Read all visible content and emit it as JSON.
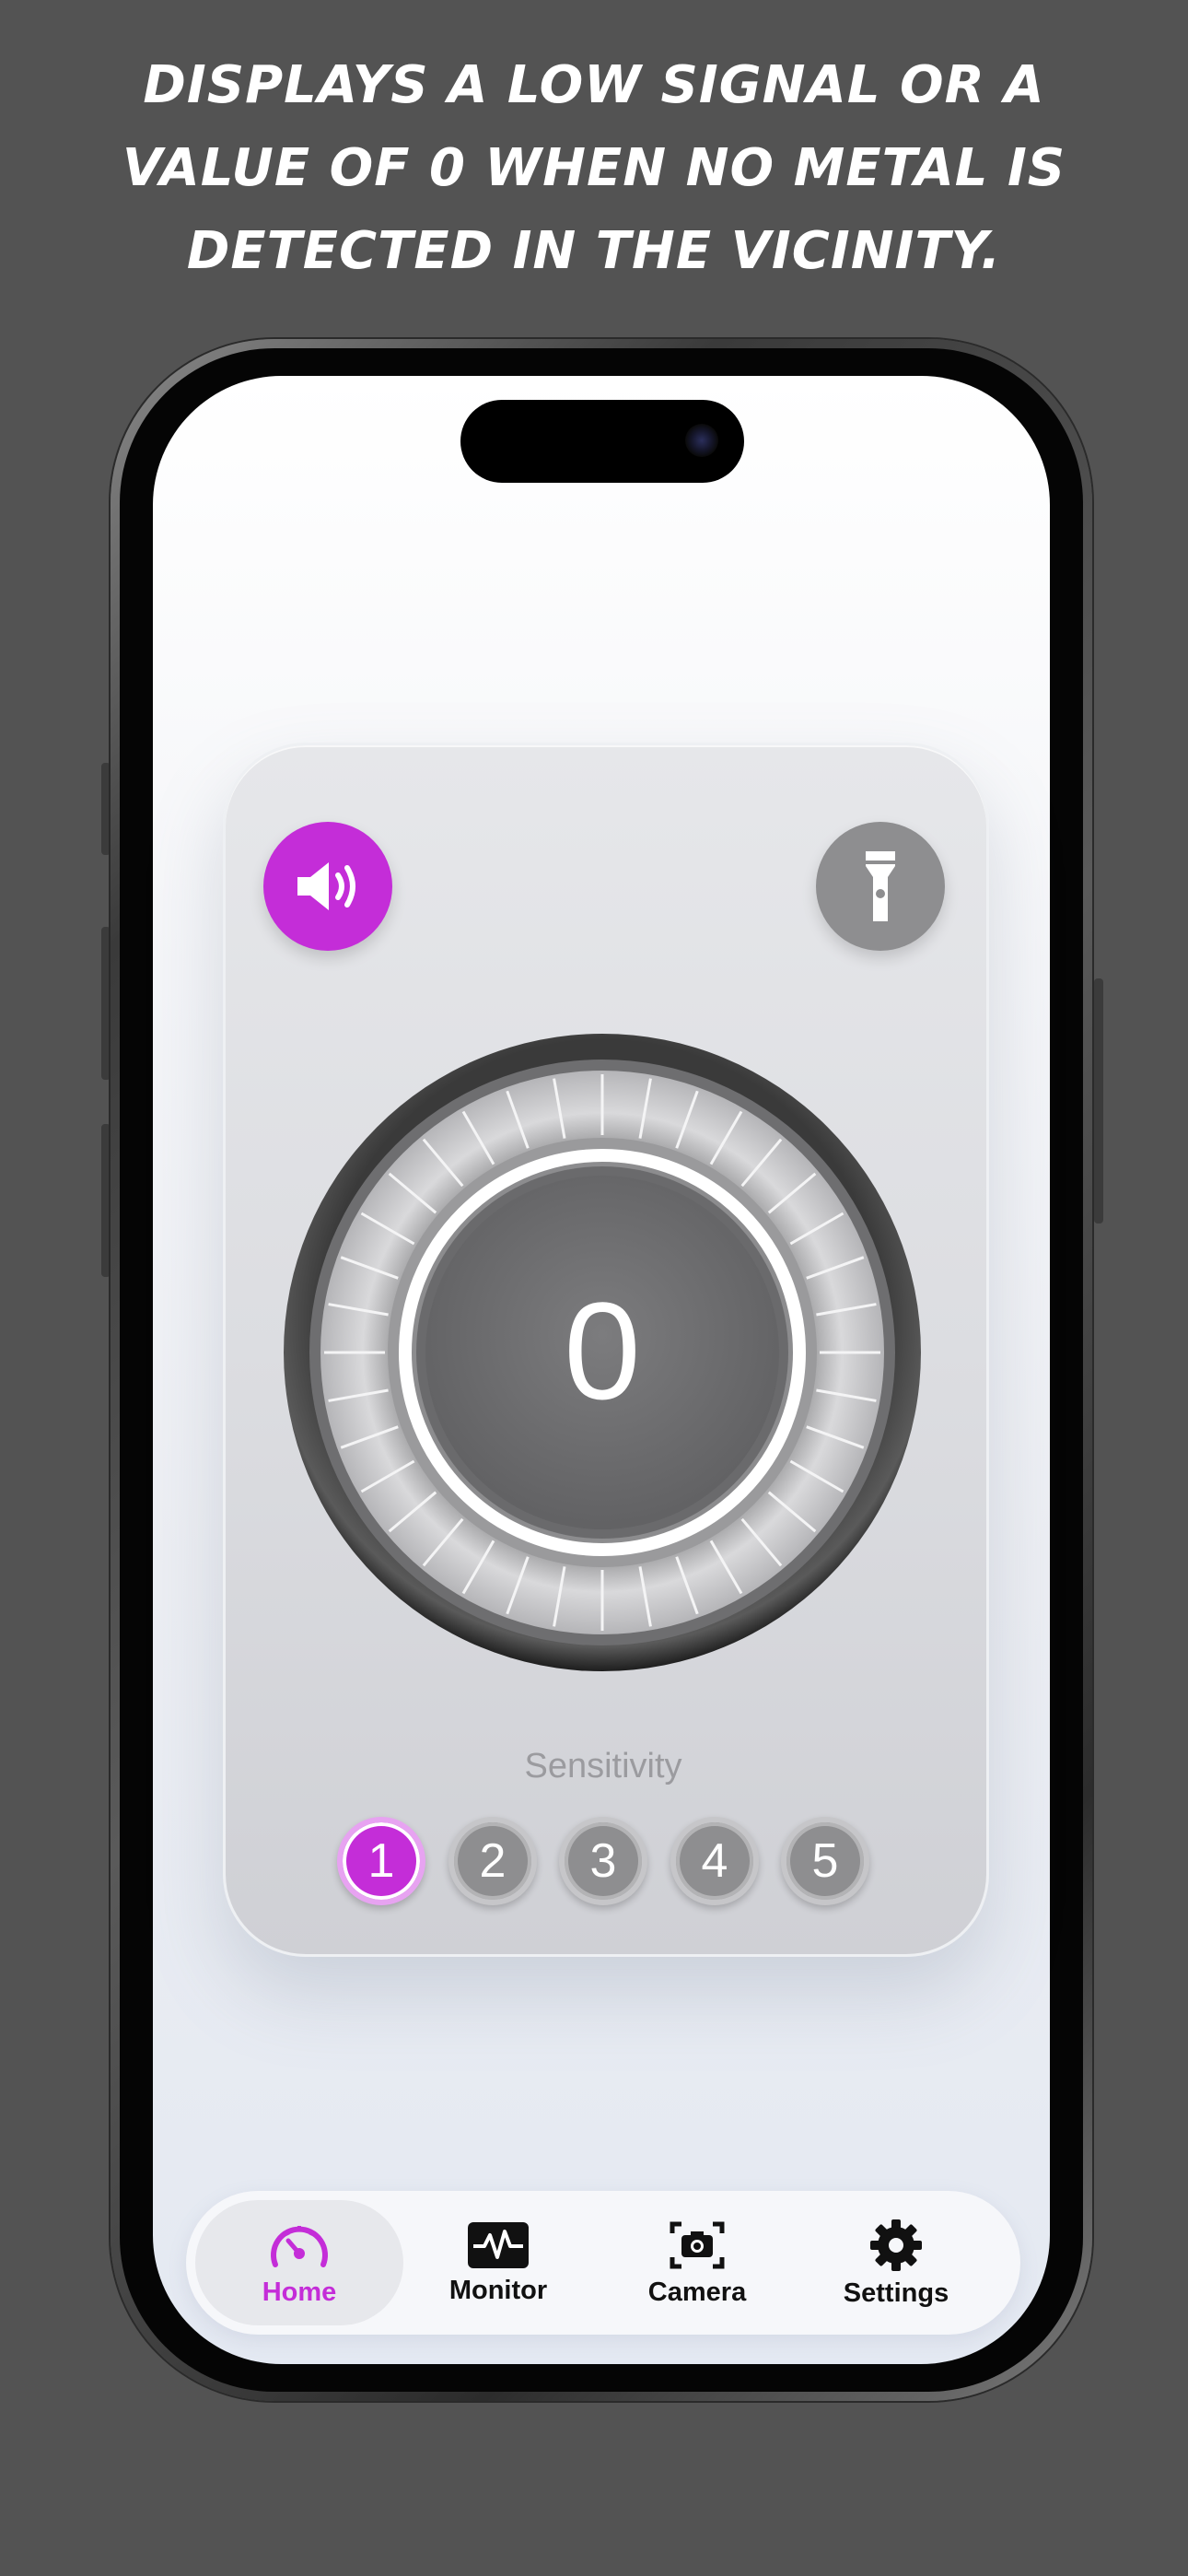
{
  "headline": {
    "line1": "Displays a low signal or a",
    "line2": "value of 0 when no metal is",
    "line3": "detected in the vicinity."
  },
  "detector": {
    "reading": "0",
    "sound_button": {
      "icon": "speaker-icon",
      "active": true
    },
    "flashlight_button": {
      "icon": "flashlight-icon",
      "active": false
    }
  },
  "sensitivity": {
    "label": "Sensitivity",
    "selected": 1,
    "levels": [
      "1",
      "2",
      "3",
      "4",
      "5"
    ]
  },
  "tabbar": {
    "tabs": [
      {
        "label": "Home",
        "icon": "speedometer-icon",
        "active": true
      },
      {
        "label": "Monitor",
        "icon": "waveform-icon",
        "active": false
      },
      {
        "label": "Camera",
        "icon": "camera-scan-icon",
        "active": false
      },
      {
        "label": "Settings",
        "icon": "gear-icon",
        "active": false
      }
    ]
  },
  "colors": {
    "accent": "#c42dd8",
    "inactive": "#8e8e90",
    "background": "#535353"
  }
}
